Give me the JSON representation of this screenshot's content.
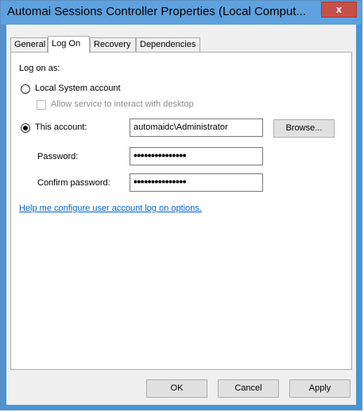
{
  "window": {
    "title": "Automai Sessions Controller Properties (Local Comput...",
    "close_glyph": "x"
  },
  "tabs": [
    {
      "label": "General"
    },
    {
      "label": "Log On"
    },
    {
      "label": "Recovery"
    },
    {
      "label": "Dependencies"
    }
  ],
  "logon": {
    "heading": "Log on as:",
    "local_system_label": "Local System account",
    "allow_interact_label": "Allow service to interact with desktop",
    "this_account_label": "This account:",
    "account_value": "automaidc\\Administrator",
    "browse_label": "Browse...",
    "password_label": "Password:",
    "password_value": "•••••••••••••••",
    "confirm_label": "Confirm password:",
    "confirm_value": "•••••••••••••••",
    "help_link": "Help me configure user account log on options."
  },
  "buttons": {
    "ok": "OK",
    "cancel": "Cancel",
    "apply": "Apply"
  }
}
